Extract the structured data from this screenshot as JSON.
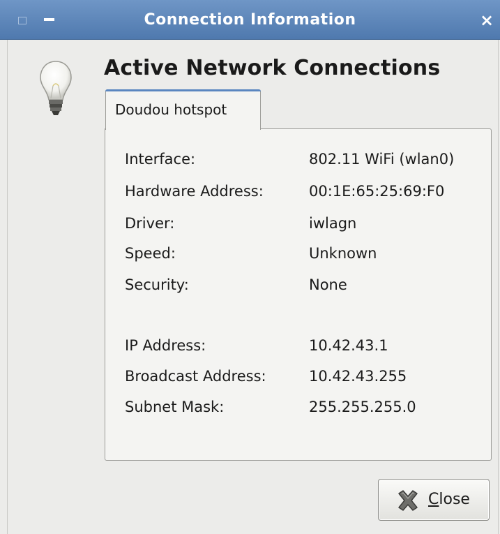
{
  "window": {
    "title": "Connection Information",
    "close_glyph": "×",
    "icons": [
      "window-menu-icon",
      "minimize-icon",
      "close-icon"
    ]
  },
  "dialog": {
    "heading": "Active Network Connections",
    "icon": "lightbulb-icon",
    "tab_label": "Doudou hotspot",
    "rows": [
      {
        "label": "Interface:",
        "value": "802.11 WiFi (wlan0)"
      },
      {
        "label": "Hardware Address:",
        "value": "00:1E:65:25:69:F0"
      },
      {
        "label": "Driver:",
        "value": "iwlagn"
      },
      {
        "label": "Speed:",
        "value": "Unknown"
      },
      {
        "label": "Security:",
        "value": "None"
      },
      {
        "label": "IP Address:",
        "value": "10.42.43.1"
      },
      {
        "label": "Broadcast Address:",
        "value": "10.42.43.255"
      },
      {
        "label": "Subnet Mask:",
        "value": "255.255.255.0"
      }
    ],
    "close_button": {
      "label_mnemonic": "C",
      "label_rest": "lose",
      "icon": "close-x-icon"
    }
  },
  "colors": {
    "titlebar": "#5f88bb",
    "tab_accent": "#5a86c0",
    "background": "#ececea",
    "panel": "#f4f4f2"
  }
}
